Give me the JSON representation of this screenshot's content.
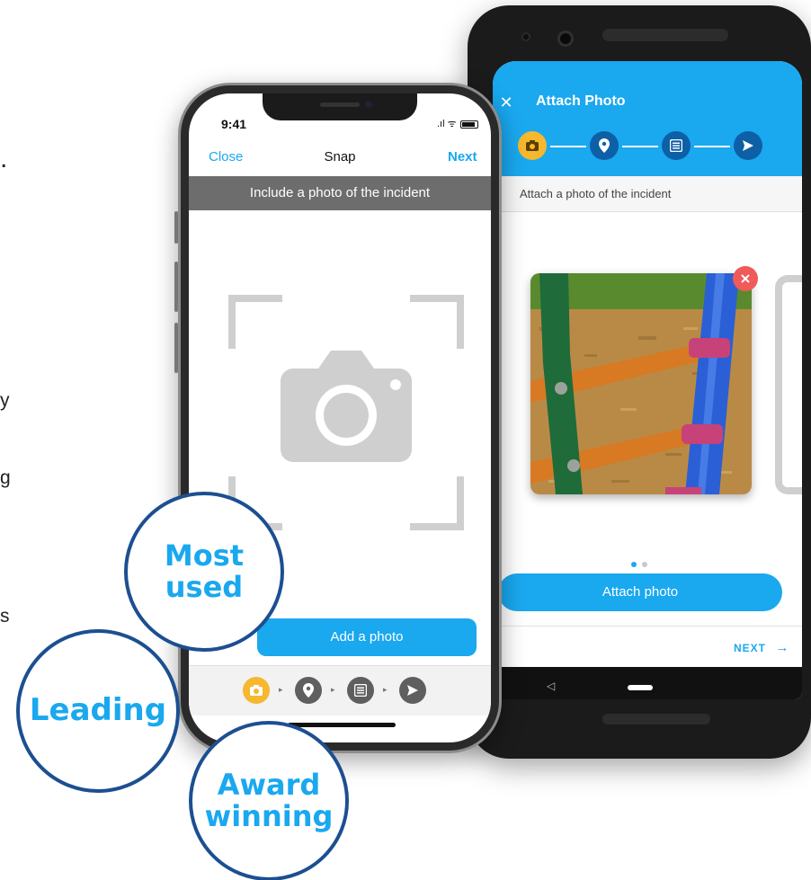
{
  "left_fragments": [
    ".",
    "y",
    "g",
    "s"
  ],
  "android": {
    "close_icon": "close-icon",
    "title": "Attach Photo",
    "steps": [
      "camera-icon",
      "location-pin-icon",
      "list-icon",
      "send-icon"
    ],
    "subtitle": "Attach a photo of the incident",
    "remove_icon": "close-icon",
    "pager_dots": 2,
    "attach_button": "Attach photo",
    "next_link": "NEXT",
    "next_arrow": "→",
    "back_glyph": "◁",
    "colors": {
      "appbar": "#1aa8ef",
      "active_step": "#f5b82e",
      "step": "#0d5fa6",
      "remove": "#f05a5a"
    }
  },
  "iphone": {
    "time": "9:41",
    "status": ".ıl ᯤ",
    "close": "Close",
    "title": "Snap",
    "next": "Next",
    "banner": "Include a photo of the incident",
    "add_button": "Add a photo",
    "toolbar_steps": [
      "camera-icon",
      "location-pin-icon",
      "list-icon",
      "send-icon"
    ],
    "colors": {
      "accent": "#1aa8ef",
      "banner": "#6d6d6d",
      "active_step": "#f5b82e"
    }
  },
  "badges": {
    "most_used": "Most\nused",
    "leading": "Leading",
    "award_winning": "Award\nwinning"
  }
}
